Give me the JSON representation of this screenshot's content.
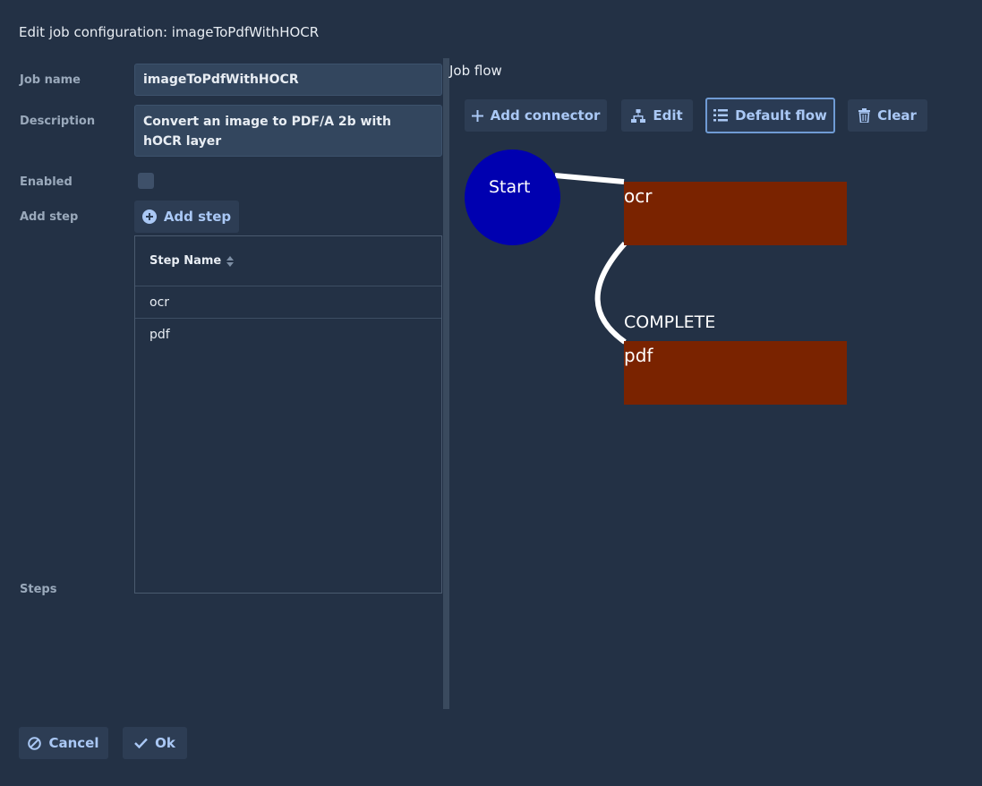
{
  "dialog": {
    "title": "Edit job configuration: imageToPdfWithHOCR"
  },
  "form": {
    "job_name_label": "Job name",
    "job_name_value": "imageToPdfWithHOCR",
    "description_label": "Description",
    "description_value": "Convert an image to PDF/A 2b with hOCR layer",
    "enabled_label": "Enabled",
    "enabled_checked": false,
    "add_step_label": "Add step",
    "add_step_button": "Add step",
    "steps_label": "Steps"
  },
  "steps_table": {
    "column_header": "Step Name",
    "rows": [
      {
        "name": "ocr"
      },
      {
        "name": "pdf"
      }
    ]
  },
  "flow": {
    "title": "Job flow",
    "toolbar": {
      "add_connector": "Add connector",
      "edit": "Edit",
      "default_flow": "Default flow",
      "clear": "Clear"
    },
    "start_node": "Start",
    "nodes": [
      {
        "label": "ocr"
      },
      {
        "label": "pdf"
      }
    ],
    "edge_label": "COMPLETE",
    "colors": {
      "start": "#0000b0",
      "step": "#7a2300",
      "edge": "#ffffff"
    }
  },
  "footer": {
    "cancel": "Cancel",
    "ok": "Ok"
  },
  "icons": {
    "add_step": "plus-circle-icon",
    "add_connector": "plus-icon",
    "edit": "sitemap-icon",
    "default_flow": "list-icon",
    "clear": "trash-icon",
    "cancel": "ban-icon",
    "ok": "check-icon",
    "sort": "sort-icon"
  },
  "theme": {
    "accent": "#aac8f5",
    "background": "#233145"
  }
}
